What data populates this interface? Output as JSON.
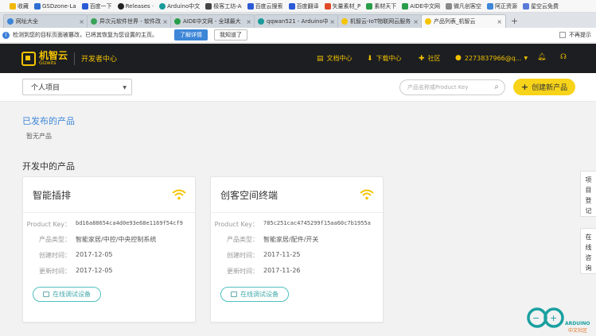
{
  "bookmarks": [
    {
      "label": "收藏",
      "color": "#f2b705"
    },
    {
      "label": "GSDzone-La",
      "color": "#2e6fd1"
    },
    {
      "label": "百度一下",
      "color": "#2b5ad6"
    },
    {
      "label": "Releases ·",
      "color": "#222222"
    },
    {
      "label": "Arduino中文",
      "color": "#1a9a9a"
    },
    {
      "label": "极客工坊-A",
      "color": "#444444"
    },
    {
      "label": "百度云搜索",
      "color": "#2b5ad6"
    },
    {
      "label": "百度翻译",
      "color": "#2b5ad6"
    },
    {
      "label": "矢量素材_P",
      "color": "#e04a2a"
    },
    {
      "label": "素材天下",
      "color": "#2a9d4a"
    },
    {
      "label": "AIDE中文网",
      "color": "#2a9d4a"
    },
    {
      "label": "微凡创客空",
      "color": "#888888"
    },
    {
      "label": "阿正资源",
      "color": "#3d86d8"
    },
    {
      "label": "星空云免费",
      "color": "#5a7ad8"
    }
  ],
  "tabs": [
    {
      "label": "网址大全",
      "color": "#3d86d8",
      "active": false
    },
    {
      "label": "异次元软件世界 - 软件改",
      "color": "#3aa35a",
      "active": false
    },
    {
      "label": "AIDE中文网 - 全球最大",
      "color": "#2a9d4a",
      "active": false
    },
    {
      "label": "qqwan521 - Arduino中",
      "color": "#1a9a9a",
      "active": false
    },
    {
      "label": "机智云-IoT物联网云服务",
      "color": "#f5c400",
      "active": false
    },
    {
      "label": "产品列表_机智云",
      "color": "#f5c400",
      "active": true
    }
  ],
  "newtab": "+",
  "infobar": {
    "text": "检测到您的目标页面被篡改，已将其恢复为您设置的主页。",
    "learn_more": "了解详情",
    "got_it": "我知道了",
    "no_more": "不再提示"
  },
  "header": {
    "logo_cn": "机智云",
    "logo_en": "Gizwits",
    "dev_center": "开发者中心",
    "nav_docs": "文档中心",
    "nav_download": "下载中心",
    "nav_community": "社区",
    "user": "2273837966@q..."
  },
  "subbar": {
    "project_select": "个人项目",
    "search_placeholder": "产品名称或Product Key",
    "create_label": "创建新产品"
  },
  "sections": {
    "published_title": "已发布的产品",
    "no_products": "暂无产品",
    "dev_title": "开发中的产品"
  },
  "labels": {
    "product_key": "Product Key：",
    "product_type": "产品类型：",
    "created": "创建时间：",
    "updated": "更新时间：",
    "debug": "在线调试设备"
  },
  "cards": [
    {
      "title": "智能插排",
      "product_key": "bd16a88654ca4d0e93e68e1169f54cf9",
      "product_type": "智能家居/中控/中央控制系统",
      "created": "2017-12-05",
      "updated": "2017-12-05"
    },
    {
      "title": "创客空间终端",
      "product_key": "785c251cac4745299f15aa60c7b1955a",
      "product_type": "智能家居/配件/开关",
      "created": "2017-11-25",
      "updated": "2017-11-26"
    }
  ],
  "side": {
    "register": [
      "项",
      "目",
      "登",
      "记"
    ],
    "consult": [
      "在",
      "线",
      "咨",
      "询"
    ]
  },
  "watermark": {
    "brand": "ARDUINO",
    "sub": "中文社区"
  },
  "colors": {
    "brand_yellow": "#f5c400",
    "header_dark": "#1c1e22",
    "link_blue": "#3d86d8",
    "debug_teal": "#4fc0c0"
  }
}
